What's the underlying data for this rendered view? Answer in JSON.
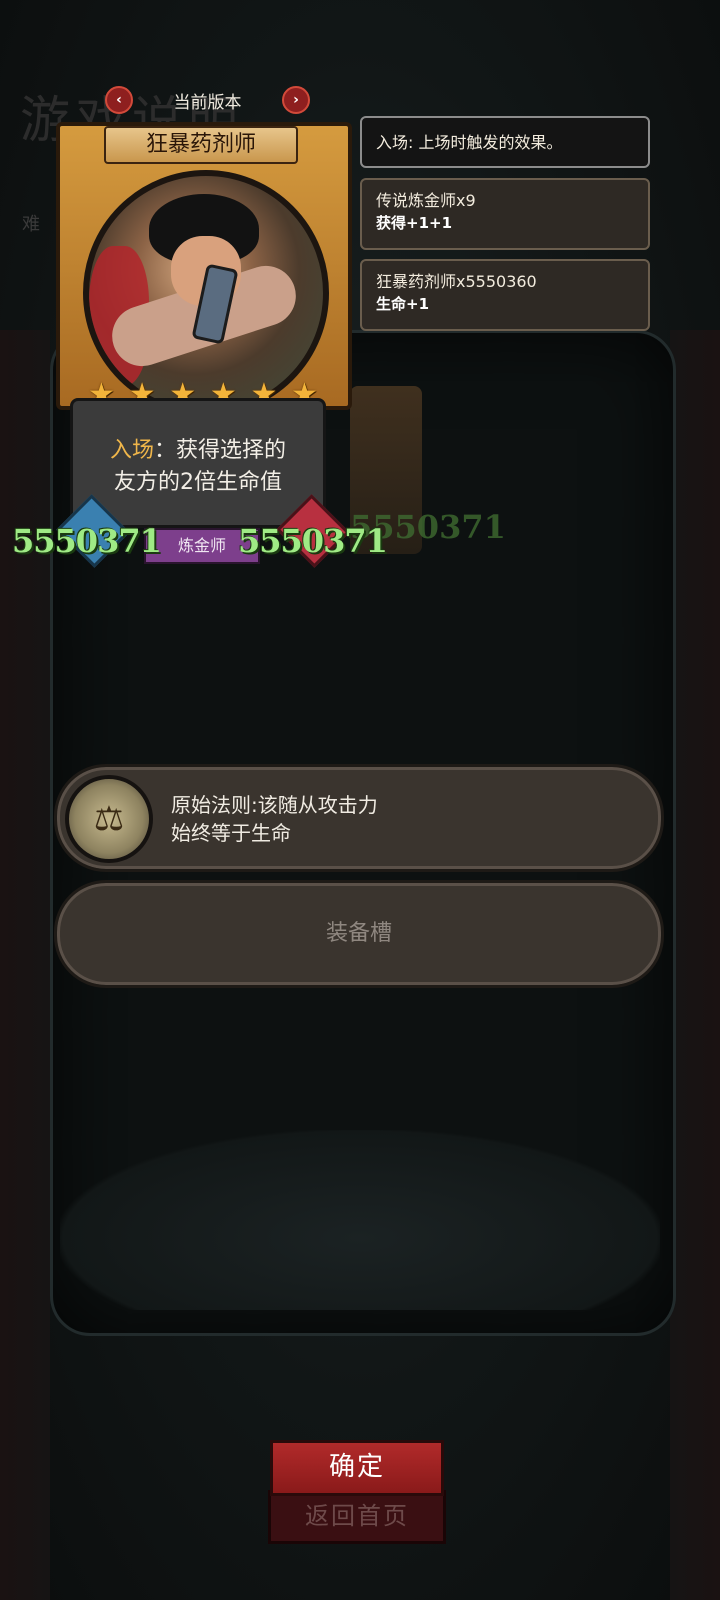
{
  "background": {
    "ghost_title": "游戏说明",
    "ghost_small": "难"
  },
  "version": {
    "label": "当前版本",
    "prev_icon": "chevron-left-icon",
    "next_icon": "chevron-right-icon"
  },
  "card": {
    "name": "狂暴药剂师",
    "stars": 6,
    "desc_keyword": "入场",
    "desc_line1_rest": "：获得选择的",
    "desc_line2": "友方的2倍生命值",
    "tribe": "炼金师",
    "attack": "5550371",
    "health": "5550371"
  },
  "ghost_card_stat": "5550371",
  "info_boxes": [
    {
      "line1": "入场: 上场时触发的效果。",
      "line2": ""
    },
    {
      "line1": "传说炼金师x9",
      "line2": "获得+1+1"
    },
    {
      "line1": "狂暴药剂师x5550360",
      "line2": "生命+1"
    }
  ],
  "law": {
    "line1": "原始法则:该随从攻击力",
    "line2": "始终等于生命",
    "icon": "scales-icon"
  },
  "equip_slot": {
    "label": "装备槽"
  },
  "buttons": {
    "confirm": "确定",
    "home": "返回首页"
  },
  "colors": {
    "accent_red": "#b12a2a",
    "stat_green": "#9fea85",
    "star_gold": "#f3b43a",
    "tribe_purple": "#7d3f8c",
    "keyword_gold": "#f0b64a"
  }
}
